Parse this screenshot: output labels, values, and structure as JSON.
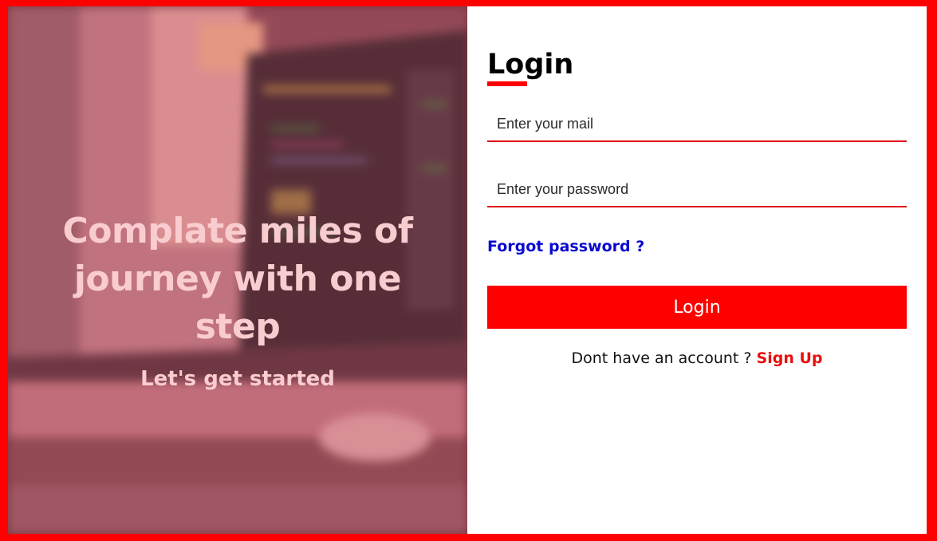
{
  "hero": {
    "title": "Complate miles of journey with one step",
    "subtitle": "Let's get started"
  },
  "login": {
    "title": "Login",
    "email_placeholder": "Enter your mail",
    "password_placeholder": "Enter your password",
    "forgot_label": "Forgot password ?",
    "button_label": "Login",
    "signup_prompt": "Dont have an account ? ",
    "signup_link": "Sign Up"
  },
  "colors": {
    "accent": "#ff0000",
    "link": "#0a0ad0",
    "hero_text": "#f9cdd0"
  }
}
